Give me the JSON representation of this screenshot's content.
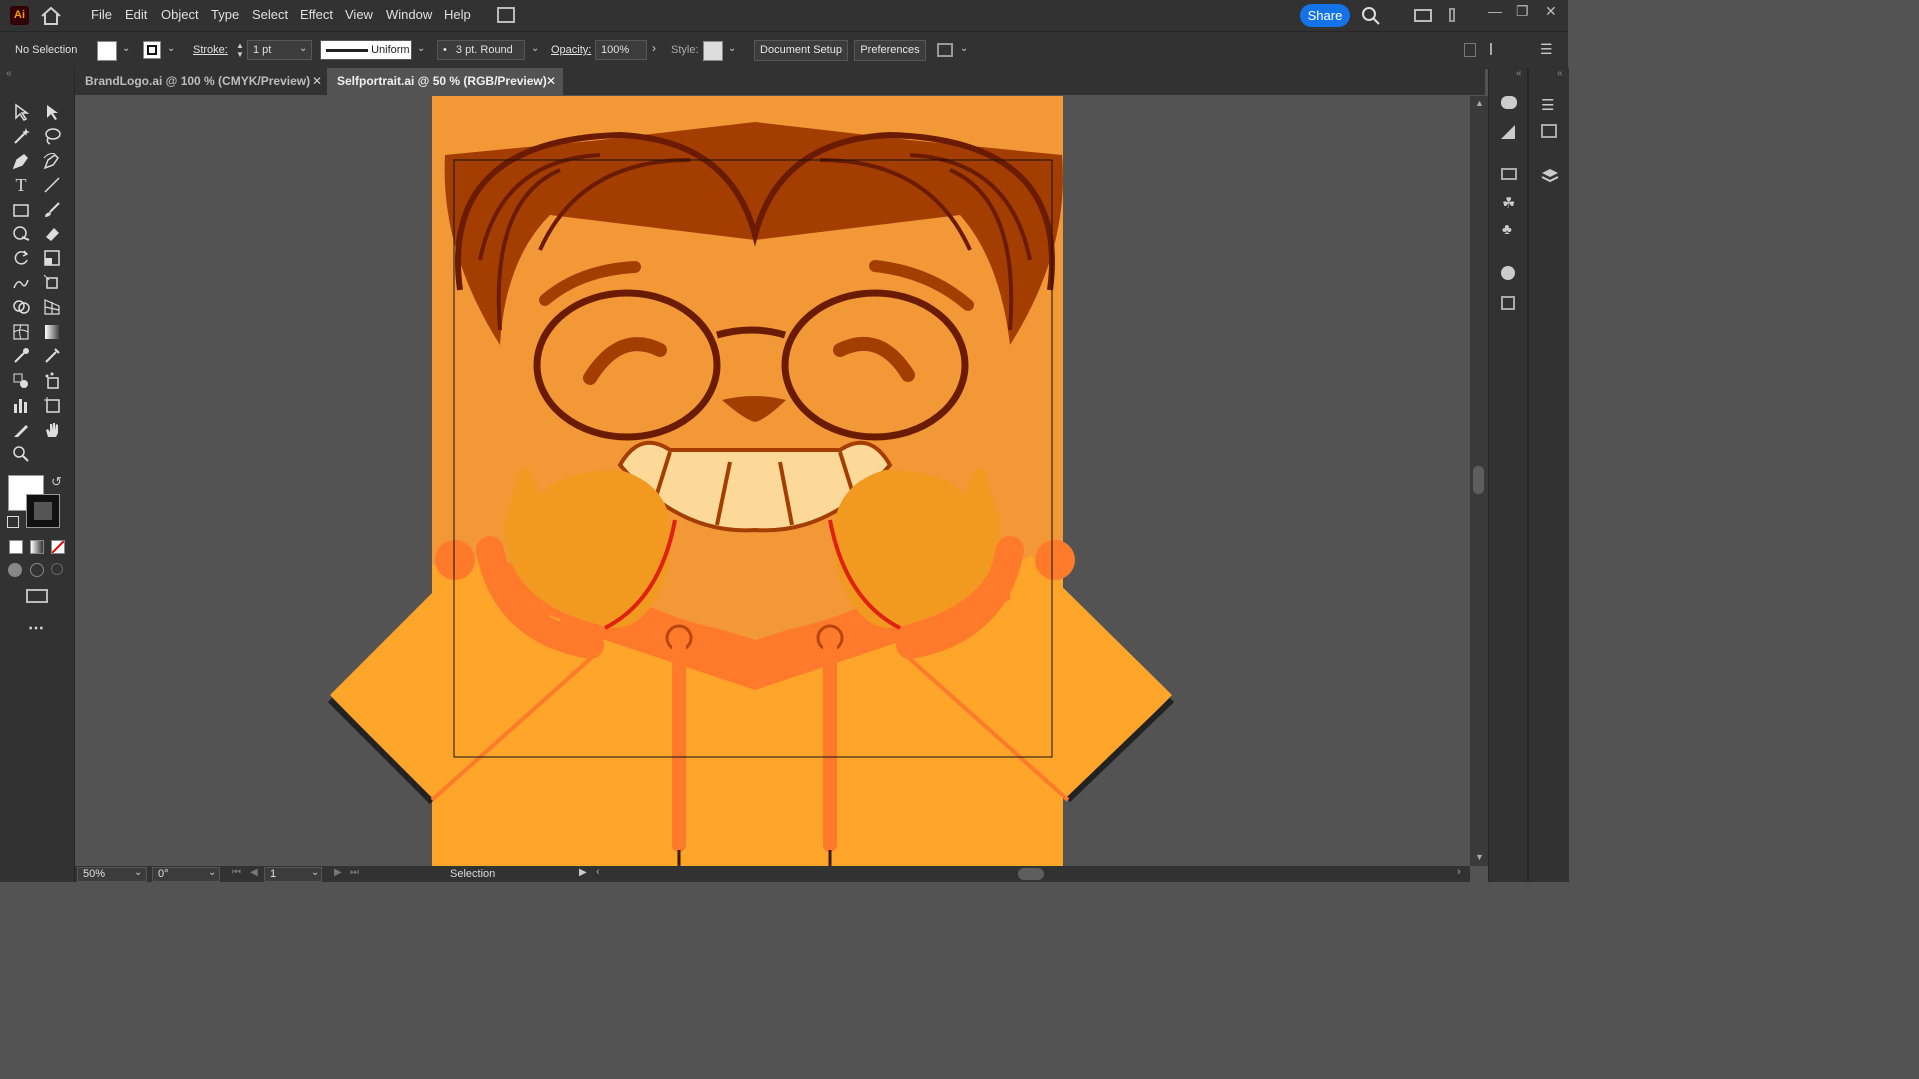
{
  "app": {
    "logo": "Ai",
    "logo_color": "#ff9a00"
  },
  "menu": {
    "items": [
      "File",
      "Edit",
      "Object",
      "Type",
      "Select",
      "Effect",
      "View",
      "Window",
      "Help"
    ],
    "share_label": "Share",
    "accent": "#1473e6"
  },
  "control": {
    "selection_label": "No Selection",
    "stroke_label": "Stroke:",
    "stroke_value": "1 pt",
    "stroke_profile": "Uniform",
    "brush": "3 pt. Round",
    "opacity_label": "Opacity:",
    "opacity_value": "100%",
    "style_label": "Style:",
    "document_setup": "Document Setup",
    "preferences": "Preferences"
  },
  "tabs": [
    {
      "label": "BrandLogo.ai @ 100 % (CMYK/Preview)",
      "active": false
    },
    {
      "label": "Selfportrait.ai @ 50 % (RGB/Preview)",
      "active": true
    }
  ],
  "tools": [
    "selection-tool",
    "direct-selection-tool",
    "magic-wand-tool",
    "lasso-tool",
    "pen-tool",
    "curvature-tool",
    "type-tool",
    "line-tool",
    "rectangle-tool",
    "paintbrush-tool",
    "shaper-tool",
    "eraser-tool",
    "rotate-tool",
    "scale-tool",
    "warp-tool",
    "free-transform-tool",
    "shape-builder-tool",
    "perspective-grid-tool",
    "mesh-tool",
    "gradient-tool",
    "eyedropper-tool",
    "measure-tool",
    "blend-tool",
    "symbol-sprayer-tool",
    "column-graph-tool",
    "artboard-tool",
    "slice-tool",
    "hand-tool",
    "zoom-tool"
  ],
  "status": {
    "zoom": "50%",
    "rotation": "0°",
    "artboard": "1",
    "mode": "Selection"
  },
  "artwork": {
    "background": "#f29837",
    "hair": "#a33e00",
    "hair_outline": "#6b1c00",
    "skin": "#f29837",
    "hoodie": "#ffa52a",
    "hoodie_dark": "#ff7a2b"
  }
}
